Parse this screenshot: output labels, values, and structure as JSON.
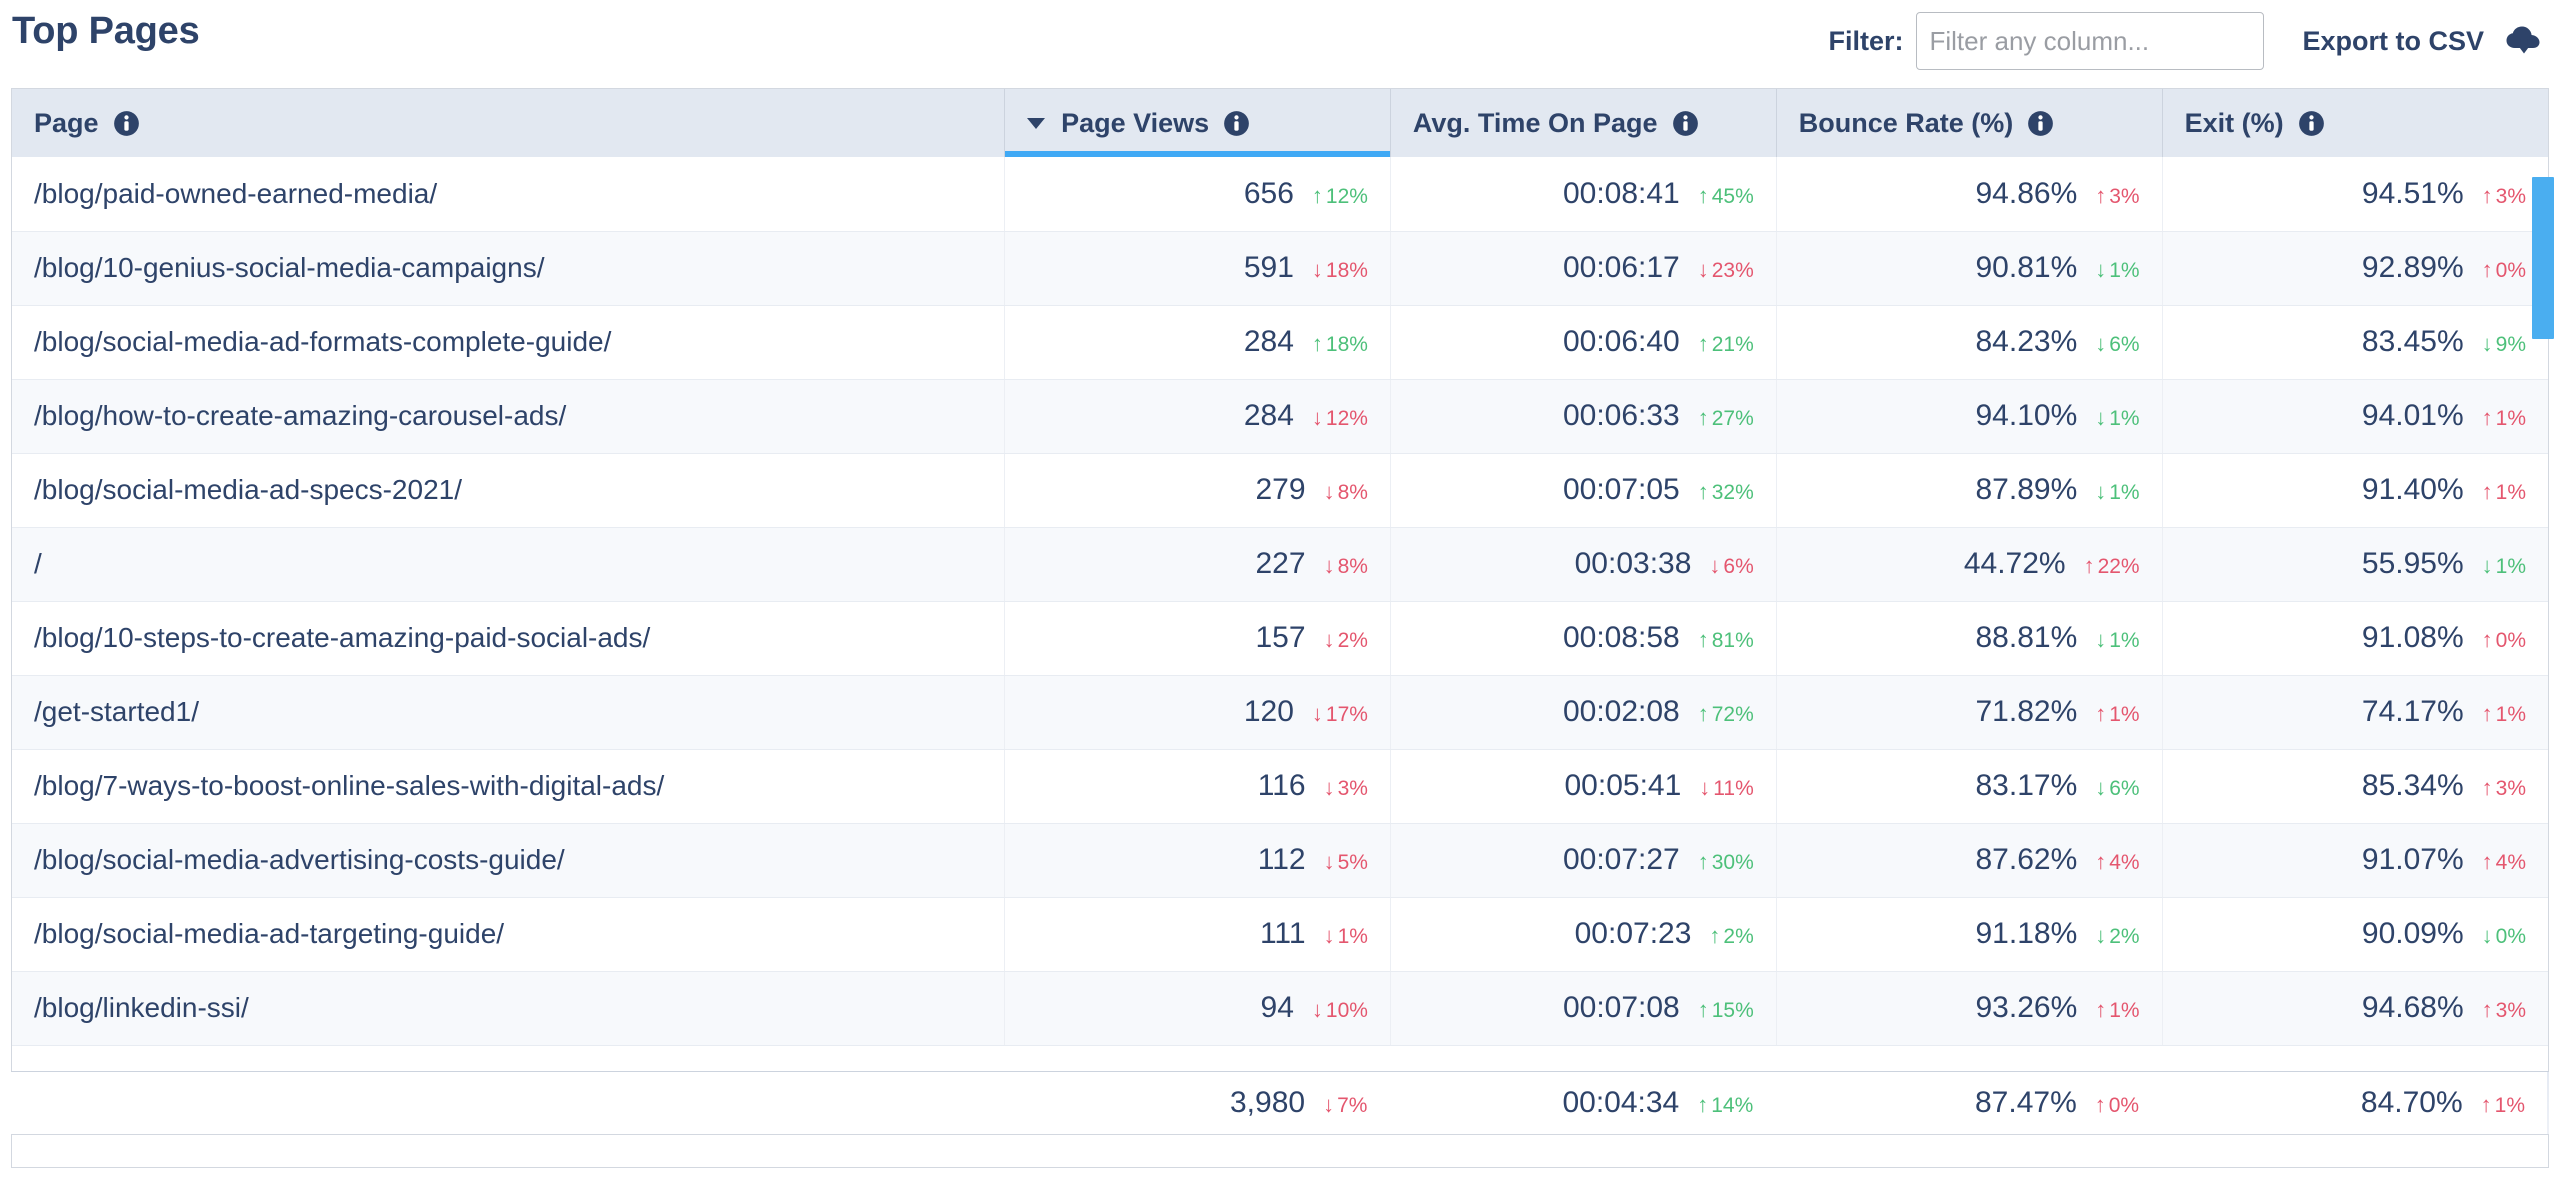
{
  "header": {
    "title": "Top Pages",
    "filter_label": "Filter:",
    "filter_value": "",
    "filter_placeholder": "Filter any column...",
    "export_label": "Export to CSV",
    "export_icon": "cloud-download-icon"
  },
  "table": {
    "columns": [
      {
        "key": "page",
        "label": "Page",
        "info_icon": "info-icon",
        "sorted": false,
        "align": "left"
      },
      {
        "key": "views",
        "label": "Page Views",
        "info_icon": "info-icon",
        "sorted": true,
        "sort_dir": "desc",
        "align": "right"
      },
      {
        "key": "time",
        "label": "Avg. Time On Page",
        "info_icon": "info-icon",
        "sorted": false,
        "align": "right"
      },
      {
        "key": "bounce",
        "label": "Bounce Rate (%)",
        "info_icon": "info-icon",
        "sorted": false,
        "align": "right"
      },
      {
        "key": "exit",
        "label": "Exit (%)",
        "info_icon": "info-icon",
        "sorted": false,
        "align": "right"
      }
    ],
    "rows": [
      {
        "page": "/blog/paid-owned-earned-media/",
        "views": "656",
        "views_delta": "12%",
        "views_dir": "up",
        "views_tone": "good",
        "time": "00:08:41",
        "time_delta": "45%",
        "time_dir": "up",
        "time_tone": "good",
        "bounce": "94.86%",
        "bounce_delta": "3%",
        "bounce_dir": "up",
        "bounce_tone": "bad",
        "exit": "94.51%",
        "exit_delta": "3%",
        "exit_dir": "up",
        "exit_tone": "bad"
      },
      {
        "page": "/blog/10-genius-social-media-campaigns/",
        "views": "591",
        "views_delta": "18%",
        "views_dir": "down",
        "views_tone": "bad",
        "time": "00:06:17",
        "time_delta": "23%",
        "time_dir": "down",
        "time_tone": "bad",
        "bounce": "90.81%",
        "bounce_delta": "1%",
        "bounce_dir": "down",
        "bounce_tone": "good",
        "exit": "92.89%",
        "exit_delta": "0%",
        "exit_dir": "up",
        "exit_tone": "bad"
      },
      {
        "page": "/blog/social-media-ad-formats-complete-guide/",
        "views": "284",
        "views_delta": "18%",
        "views_dir": "up",
        "views_tone": "good",
        "time": "00:06:40",
        "time_delta": "21%",
        "time_dir": "up",
        "time_tone": "good",
        "bounce": "84.23%",
        "bounce_delta": "6%",
        "bounce_dir": "down",
        "bounce_tone": "good",
        "exit": "83.45%",
        "exit_delta": "9%",
        "exit_dir": "down",
        "exit_tone": "good"
      },
      {
        "page": "/blog/how-to-create-amazing-carousel-ads/",
        "views": "284",
        "views_delta": "12%",
        "views_dir": "down",
        "views_tone": "bad",
        "time": "00:06:33",
        "time_delta": "27%",
        "time_dir": "up",
        "time_tone": "good",
        "bounce": "94.10%",
        "bounce_delta": "1%",
        "bounce_dir": "down",
        "bounce_tone": "good",
        "exit": "94.01%",
        "exit_delta": "1%",
        "exit_dir": "up",
        "exit_tone": "bad"
      },
      {
        "page": "/blog/social-media-ad-specs-2021/",
        "views": "279",
        "views_delta": "8%",
        "views_dir": "down",
        "views_tone": "bad",
        "time": "00:07:05",
        "time_delta": "32%",
        "time_dir": "up",
        "time_tone": "good",
        "bounce": "87.89%",
        "bounce_delta": "1%",
        "bounce_dir": "down",
        "bounce_tone": "good",
        "exit": "91.40%",
        "exit_delta": "1%",
        "exit_dir": "up",
        "exit_tone": "bad"
      },
      {
        "page": "/",
        "views": "227",
        "views_delta": "8%",
        "views_dir": "down",
        "views_tone": "bad",
        "time": "00:03:38",
        "time_delta": "6%",
        "time_dir": "down",
        "time_tone": "bad",
        "bounce": "44.72%",
        "bounce_delta": "22%",
        "bounce_dir": "up",
        "bounce_tone": "bad",
        "exit": "55.95%",
        "exit_delta": "1%",
        "exit_dir": "down",
        "exit_tone": "good"
      },
      {
        "page": "/blog/10-steps-to-create-amazing-paid-social-ads/",
        "views": "157",
        "views_delta": "2%",
        "views_dir": "down",
        "views_tone": "bad",
        "time": "00:08:58",
        "time_delta": "81%",
        "time_dir": "up",
        "time_tone": "good",
        "bounce": "88.81%",
        "bounce_delta": "1%",
        "bounce_dir": "down",
        "bounce_tone": "good",
        "exit": "91.08%",
        "exit_delta": "0%",
        "exit_dir": "up",
        "exit_tone": "bad"
      },
      {
        "page": "/get-started1/",
        "views": "120",
        "views_delta": "17%",
        "views_dir": "down",
        "views_tone": "bad",
        "time": "00:02:08",
        "time_delta": "72%",
        "time_dir": "up",
        "time_tone": "good",
        "bounce": "71.82%",
        "bounce_delta": "1%",
        "bounce_dir": "up",
        "bounce_tone": "bad",
        "exit": "74.17%",
        "exit_delta": "1%",
        "exit_dir": "up",
        "exit_tone": "bad"
      },
      {
        "page": "/blog/7-ways-to-boost-online-sales-with-digital-ads/",
        "views": "116",
        "views_delta": "3%",
        "views_dir": "down",
        "views_tone": "bad",
        "time": "00:05:41",
        "time_delta": "11%",
        "time_dir": "down",
        "time_tone": "bad",
        "bounce": "83.17%",
        "bounce_delta": "6%",
        "bounce_dir": "down",
        "bounce_tone": "good",
        "exit": "85.34%",
        "exit_delta": "3%",
        "exit_dir": "up",
        "exit_tone": "bad"
      },
      {
        "page": "/blog/social-media-advertising-costs-guide/",
        "views": "112",
        "views_delta": "5%",
        "views_dir": "down",
        "views_tone": "bad",
        "time": "00:07:27",
        "time_delta": "30%",
        "time_dir": "up",
        "time_tone": "good",
        "bounce": "87.62%",
        "bounce_delta": "4%",
        "bounce_dir": "up",
        "bounce_tone": "bad",
        "exit": "91.07%",
        "exit_delta": "4%",
        "exit_dir": "up",
        "exit_tone": "bad"
      },
      {
        "page": "/blog/social-media-ad-targeting-guide/",
        "views": "111",
        "views_delta": "1%",
        "views_dir": "down",
        "views_tone": "bad",
        "time": "00:07:23",
        "time_delta": "2%",
        "time_dir": "up",
        "time_tone": "good",
        "bounce": "91.18%",
        "bounce_delta": "2%",
        "bounce_dir": "down",
        "bounce_tone": "good",
        "exit": "90.09%",
        "exit_delta": "0%",
        "exit_dir": "down",
        "exit_tone": "good"
      },
      {
        "page": "/blog/linkedin-ssi/",
        "views": "94",
        "views_delta": "10%",
        "views_dir": "down",
        "views_tone": "bad",
        "time": "00:07:08",
        "time_delta": "15%",
        "time_dir": "up",
        "time_tone": "good",
        "bounce": "93.26%",
        "bounce_delta": "1%",
        "bounce_dir": "up",
        "bounce_tone": "bad",
        "exit": "94.68%",
        "exit_delta": "3%",
        "exit_dir": "up",
        "exit_tone": "bad"
      }
    ],
    "totals": {
      "page": "",
      "views": "3,980",
      "views_delta": "7%",
      "views_dir": "down",
      "views_tone": "bad",
      "time": "00:04:34",
      "time_delta": "14%",
      "time_dir": "up",
      "time_tone": "good",
      "bounce": "87.47%",
      "bounce_delta": "0%",
      "bounce_dir": "up",
      "bounce_tone": "bad",
      "exit": "84.70%",
      "exit_delta": "1%",
      "exit_dir": "up",
      "exit_tone": "bad"
    }
  },
  "scrollbar": {
    "orientation": "vertical",
    "thumb_color": "#4aaef0"
  },
  "colors": {
    "title": "#2e4369",
    "header_bg": "#e2e8f1",
    "sort_underline": "#3fa9f5",
    "positive": "#4dc07a",
    "negative": "#e4566e",
    "row_alt": "#f7f9fc"
  }
}
